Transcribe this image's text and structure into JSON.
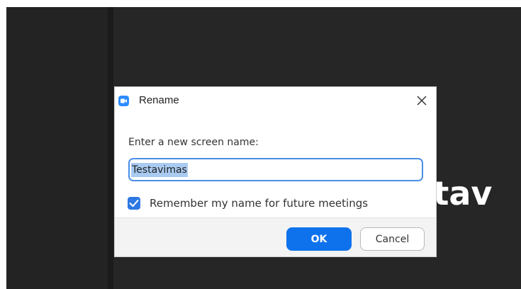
{
  "background": {
    "participant_name_fragment": "stav"
  },
  "dialog": {
    "title": "Rename",
    "prompt": "Enter a new screen name:",
    "input_value": "Testavimas",
    "remember_checked": true,
    "remember_label": "Remember my name for future meetings",
    "ok_label": "OK",
    "cancel_label": "Cancel"
  },
  "icons": {
    "app": "zoom-camera-icon",
    "close": "close-icon",
    "checkbox": "checkmark-icon"
  },
  "colors": {
    "accent": "#0e72ed",
    "app_icon": "#2d8cff",
    "background_dark": "#262626",
    "selection": "#a9cbf2"
  }
}
